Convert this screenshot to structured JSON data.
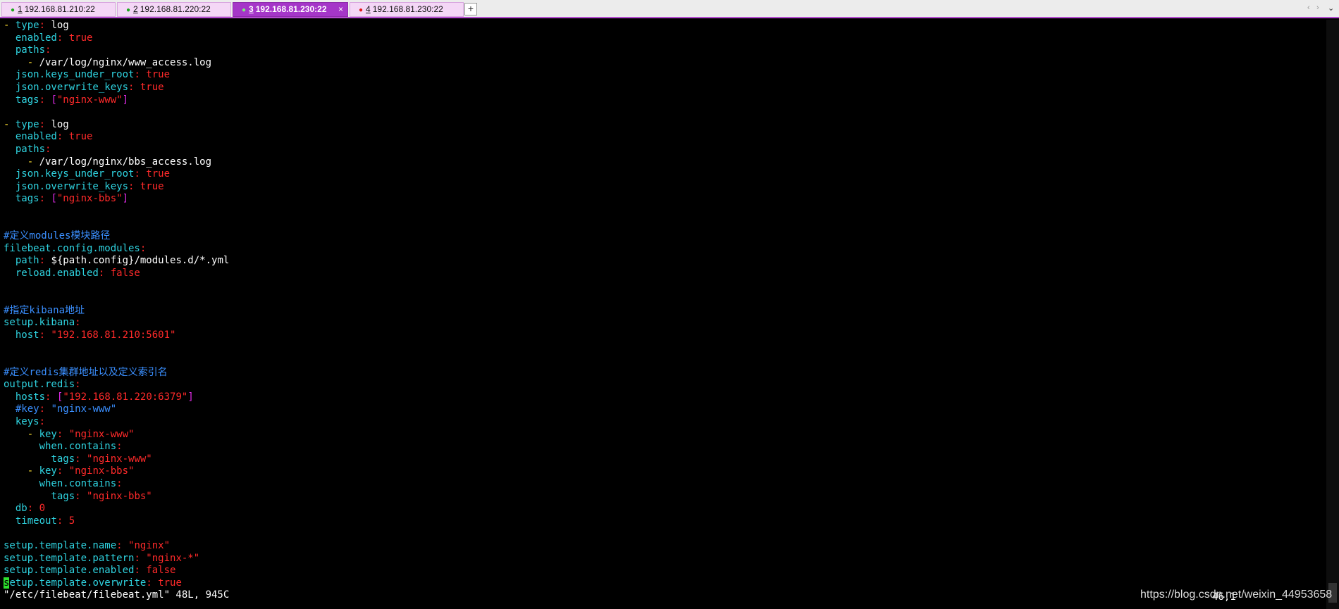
{
  "tabs": [
    {
      "num": "1",
      "label": "192.168.81.210:22",
      "dot_color": "#1ea91e"
    },
    {
      "num": "2",
      "label": "192.168.81.220:22",
      "dot_color": "#1ea91e"
    },
    {
      "num": "3",
      "label": "192.168.81.230:22",
      "dot_color": "#1ea91e"
    },
    {
      "num": "4",
      "label": "192.168.81.230:22",
      "dot_color": "#e21b1b"
    }
  ],
  "active_tab_close": "×",
  "add_tab": "+",
  "nav_prev": "‹",
  "nav_next": "›",
  "nav_menu": "⌄",
  "terminal": {
    "lines": [
      [
        [
          "y",
          "- "
        ],
        [
          "k",
          "type"
        ],
        [
          "r",
          ": "
        ],
        [
          "v",
          "log"
        ]
      ],
      [
        [
          "k",
          "  enabled"
        ],
        [
          "r",
          ": true"
        ]
      ],
      [
        [
          "k",
          "  paths"
        ],
        [
          "r",
          ":"
        ]
      ],
      [
        [
          "y",
          "    - "
        ],
        [
          "v",
          "/var/log/nginx/www_access.log"
        ]
      ],
      [
        [
          "k",
          "  json.keys_under_root"
        ],
        [
          "r",
          ": true"
        ]
      ],
      [
        [
          "k",
          "  json.overwrite_keys"
        ],
        [
          "r",
          ": true"
        ]
      ],
      [
        [
          "k",
          "  tags"
        ],
        [
          "r",
          ": "
        ],
        [
          "m",
          "["
        ],
        [
          "r",
          "\"nginx-www\""
        ],
        [
          "m",
          "]"
        ]
      ],
      [],
      [
        [
          "y",
          "- "
        ],
        [
          "k",
          "type"
        ],
        [
          "r",
          ": "
        ],
        [
          "v",
          "log"
        ]
      ],
      [
        [
          "k",
          "  enabled"
        ],
        [
          "r",
          ": true"
        ]
      ],
      [
        [
          "k",
          "  paths"
        ],
        [
          "r",
          ":"
        ]
      ],
      [
        [
          "y",
          "    - "
        ],
        [
          "v",
          "/var/log/nginx/bbs_access.log"
        ]
      ],
      [
        [
          "k",
          "  json.keys_under_root"
        ],
        [
          "r",
          ": true"
        ]
      ],
      [
        [
          "k",
          "  json.overwrite_keys"
        ],
        [
          "r",
          ": true"
        ]
      ],
      [
        [
          "k",
          "  tags"
        ],
        [
          "r",
          ": "
        ],
        [
          "m",
          "["
        ],
        [
          "r",
          "\"nginx-bbs\""
        ],
        [
          "m",
          "]"
        ]
      ],
      [],
      [],
      [
        [
          "c",
          "#定义modules模块路径"
        ]
      ],
      [
        [
          "k",
          "filebeat.config.modules"
        ],
        [
          "r",
          ":"
        ]
      ],
      [
        [
          "k",
          "  path"
        ],
        [
          "r",
          ": "
        ],
        [
          "v",
          "${path.config}/modules.d/*.yml"
        ]
      ],
      [
        [
          "k",
          "  reload.enabled"
        ],
        [
          "r",
          ": false"
        ]
      ],
      [],
      [],
      [
        [
          "c",
          "#指定kibana地址"
        ]
      ],
      [
        [
          "k",
          "setup.kibana"
        ],
        [
          "r",
          ":"
        ]
      ],
      [
        [
          "k",
          "  host"
        ],
        [
          "r",
          ": \"192.168.81.210:5601\""
        ]
      ],
      [],
      [],
      [
        [
          "c",
          "#定义redis集群地址以及定义索引名"
        ]
      ],
      [
        [
          "k",
          "output.redis"
        ],
        [
          "r",
          ":"
        ]
      ],
      [
        [
          "k",
          "  hosts"
        ],
        [
          "r",
          ": "
        ],
        [
          "m",
          "["
        ],
        [
          "r",
          "\"192.168.81.220:6379\""
        ],
        [
          "m",
          "]"
        ]
      ],
      [
        [
          "c",
          "  #key"
        ],
        [
          "r",
          ": "
        ],
        [
          "c",
          "\"nginx-www\""
        ]
      ],
      [
        [
          "k",
          "  keys"
        ],
        [
          "r",
          ":"
        ]
      ],
      [
        [
          "y",
          "    - "
        ],
        [
          "k",
          "key"
        ],
        [
          "r",
          ": \"nginx-www\""
        ]
      ],
      [
        [
          "k",
          "      when.contains"
        ],
        [
          "r",
          ":"
        ]
      ],
      [
        [
          "k",
          "        tags"
        ],
        [
          "r",
          ": \"nginx-www\""
        ]
      ],
      [
        [
          "y",
          "    - "
        ],
        [
          "k",
          "key"
        ],
        [
          "r",
          ": \"nginx-bbs\""
        ]
      ],
      [
        [
          "k",
          "      when.contains"
        ],
        [
          "r",
          ":"
        ]
      ],
      [
        [
          "k",
          "        tags"
        ],
        [
          "r",
          ": \"nginx-bbs\""
        ]
      ],
      [
        [
          "k",
          "  db"
        ],
        [
          "r",
          ": 0"
        ]
      ],
      [
        [
          "k",
          "  timeout"
        ],
        [
          "r",
          ": 5"
        ]
      ],
      [],
      [
        [
          "k",
          "setup.template.name"
        ],
        [
          "r",
          ": \"nginx\""
        ]
      ],
      [
        [
          "k",
          "setup.template.pattern"
        ],
        [
          "r",
          ": \"nginx-*\""
        ]
      ],
      [
        [
          "k",
          "setup.template.enabled"
        ],
        [
          "r",
          ": false"
        ]
      ],
      [
        [
          "cursor",
          "s"
        ],
        [
          "k",
          "etup.template.overwrite"
        ],
        [
          "r",
          ": true"
        ]
      ],
      [
        [
          "v",
          "\"/etc/filebeat/filebeat.yml\" 48L, 945C"
        ]
      ]
    ]
  },
  "ruler": "46,1",
  "watermark": "https://blog.csdn.net/weixin_44953658"
}
